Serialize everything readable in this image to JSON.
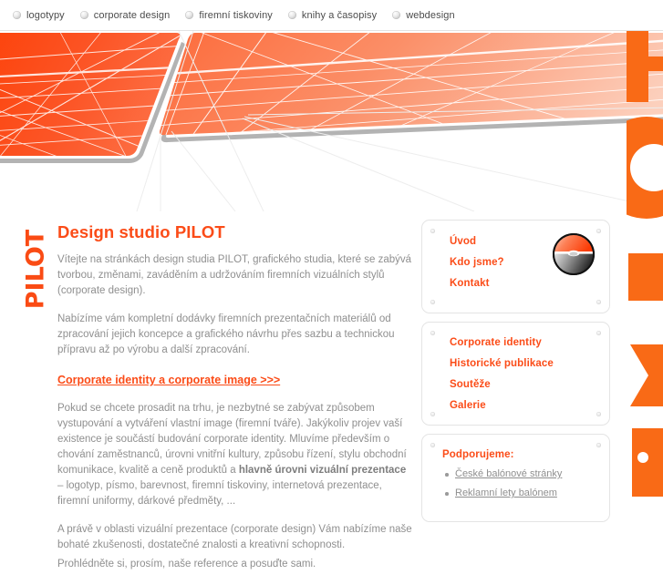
{
  "topnav": {
    "items": [
      {
        "label": "logotypy",
        "icon": "bullet-sphere-icon"
      },
      {
        "label": "corporate design",
        "icon": "bullet-sphere-icon"
      },
      {
        "label": "firemní tiskoviny",
        "icon": "bullet-sphere-icon"
      },
      {
        "label": "knihy a časopisy",
        "icon": "bullet-sphere-icon"
      },
      {
        "label": "webdesign",
        "icon": "bullet-sphere-icon"
      }
    ]
  },
  "branding": {
    "vertical_logo": "PILOT",
    "edge_letters": "PILOT"
  },
  "article": {
    "title": "Design studio PILOT",
    "p1": "Vítejte na stránkách design studia PILOT, grafického studia, které se zabývá tvorbou, změnami, zaváděním a udržováním firemních vizuálních stylů (corporate design).",
    "p2": "Nabízíme vám kompletní dodávky firemních prezentačních materiálů od zpracování jejich koncepce a grafického návrhu přes sazbu a technickou přípravu až po výrobu a další zpracování.",
    "ci_link": "Corporate identity a corporate image >>>",
    "p3_part1": "Pokud se chcete prosadit na trhu, je nezbytné se zabývat způsobem vystupování a vytváření vlastní image (firemní tváře). Jakýkoliv projev vaší existence je součástí budování corporate identity. Mluvíme především o chování zaměstnanců, úrovni vnitřní kultury, způsobu řízení, stylu obchodní komunikace, kvalitě a ceně produktů a ",
    "p3_bold": "hlavně úrovni vizuální prezentace",
    "p3_part2": " – logotyp, písmo, barevnost, firemní tiskoviny, internetová prezentace, firemní uniformy, dárkové předměty, ...",
    "p4": "A právě v oblasti vizuální prezentace (corporate design) Vám nabízíme naše bohaté zkušenosti, dostatečné znalosti a kreativní schopnosti.",
    "p5": "Prohlédněte si, prosím, naše reference a posuďte sami."
  },
  "sidebar": {
    "nav_panel": {
      "emblem": "sphere-horizon-icon",
      "links": [
        {
          "label": "Úvod"
        },
        {
          "label": "Kdo jsme?"
        },
        {
          "label": "Kontakt"
        }
      ]
    },
    "sections_panel": {
      "links": [
        {
          "label": "Corporate identity"
        },
        {
          "label": "Historické publikace"
        },
        {
          "label": "Soutěže"
        },
        {
          "label": "Galerie"
        }
      ]
    },
    "support_panel": {
      "heading": "Podporujeme:",
      "links": [
        {
          "label": "České balónové stránky"
        },
        {
          "label": "Reklamní lety balónem"
        }
      ]
    }
  },
  "colors": {
    "accent_orange": "#fb4c18",
    "banner_orange_dark": "#fc4a12",
    "banner_orange_light": "#fbb89e",
    "body_text": "#8f8f8f",
    "nav_text": "#4c4c4c",
    "panel_border": "#e4e4e4"
  }
}
